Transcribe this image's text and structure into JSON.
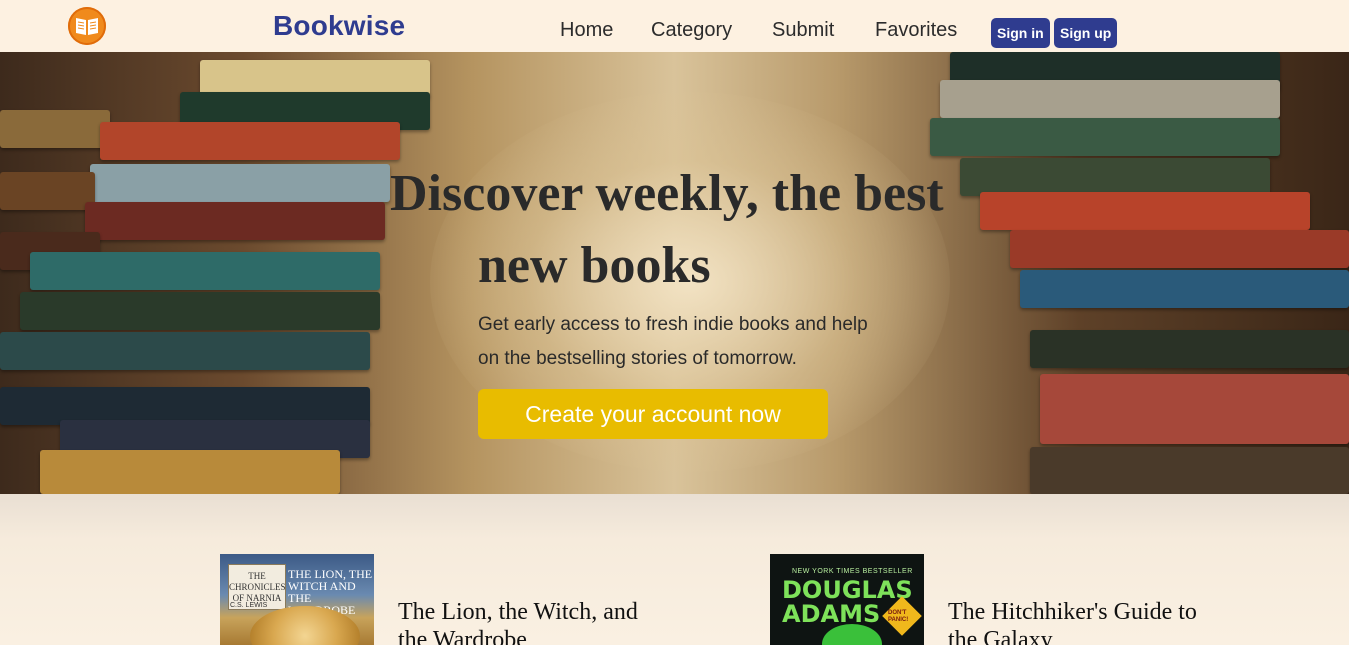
{
  "header": {
    "brand": "Bookwise",
    "nav": [
      "Home",
      "Category",
      "Submit",
      "Favorites"
    ],
    "sign_in": "Sign in",
    "sign_up": "Sign up",
    "logo_icon": "open-book-icon",
    "accent": "#2f3c8f"
  },
  "hero": {
    "title_line1": "Discover weekly, the best",
    "title_line2": "new books",
    "subtitle_line1": "Get early access to fresh indie books and help",
    "subtitle_line2": "on the bestselling stories of tomorrow.",
    "cta": "Create your account now",
    "cta_color": "#e8bc00"
  },
  "books": [
    {
      "title": "The Lion, the Witch, and the Wardrobe",
      "cover": {
        "series": "THE CHRONICLES OF NARNIA",
        "cover_title": "THE LION, THE WITCH AND THE WARDROBE",
        "author": "C.S. LEWIS"
      }
    },
    {
      "title": "The Hitchhiker's Guide to the Galaxy",
      "cover": {
        "tagline": "NEW YORK TIMES BESTSELLER",
        "author": "DOUGLAS ADAMS",
        "badge": "DON'T PANIC!"
      }
    }
  ]
}
